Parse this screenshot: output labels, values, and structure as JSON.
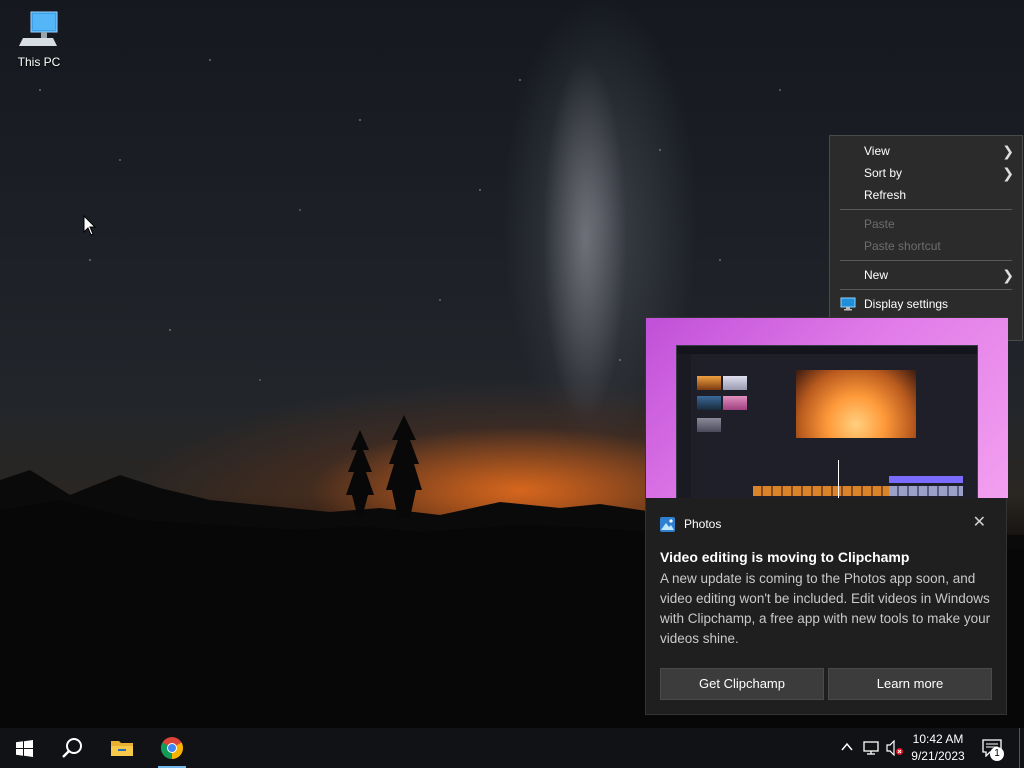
{
  "desktop": {
    "icons": [
      {
        "label": "This PC",
        "icon": "computer-icon"
      }
    ]
  },
  "context_menu": {
    "items": [
      {
        "label": "View",
        "submenu": true
      },
      {
        "label": "Sort by",
        "submenu": true
      },
      {
        "label": "Refresh"
      },
      {
        "label": "Paste",
        "disabled": true
      },
      {
        "label": "Paste shortcut",
        "disabled": true
      },
      {
        "label": "New",
        "submenu": true
      },
      {
        "label": "Display settings",
        "icon": "display-icon"
      }
    ]
  },
  "toast": {
    "app_name": "Photos",
    "title": "Video editing is moving to Clipchamp",
    "body": "A new update is coming to the Photos app soon, and video editing won't be included. Edit videos in Windows with Clipchamp, a free app with new tools to make your videos shine.",
    "primary_button": "Get Clipchamp",
    "secondary_button": "Learn more",
    "close_icon": "close-icon",
    "accent_color": "#c050d8"
  },
  "taskbar": {
    "pinned": [
      "windows-start-icon",
      "search-icon",
      "file-explorer-icon",
      "chrome-icon"
    ],
    "tray": [
      "chevron-up-icon",
      "network-icon",
      "volume-muted-icon"
    ],
    "time": "10:42 AM",
    "date": "9/21/2023",
    "notification_count": "1"
  }
}
